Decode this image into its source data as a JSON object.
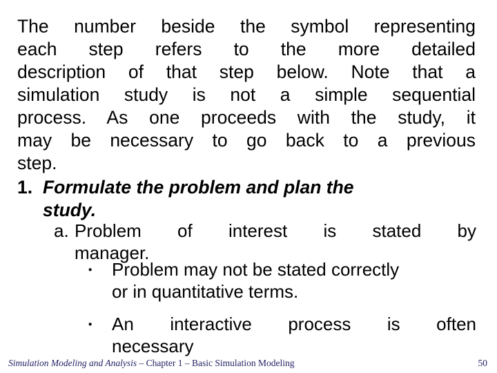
{
  "slide": {
    "background_color": "#ffffff",
    "text_color": "#000000",
    "footer_color": "#1f1f63",
    "paragraph": {
      "lines": [
        "The number beside the symbol representing",
        "each step refers to the more detailed",
        "description of that step below.  Note that a",
        "simulation study is not a simple sequential",
        "process.  As one proceeds with the study, it",
        "may be necessary to go back to a previous",
        "step."
      ]
    },
    "items": [
      {
        "marker": "1.",
        "lines": [
          "Formulate the problem and plan the",
          "study."
        ]
      },
      {
        "marker": "a.",
        "lines": [
          "Problem of interest is stated by",
          "manager."
        ]
      },
      {
        "marker": "§",
        "bullet_glyph": "▪",
        "lines": [
          "Problem may not be stated correctly",
          "or in quantitative terms."
        ]
      },
      {
        "marker": "§",
        "bullet_glyph": "▪",
        "lines": [
          "An interactive process is often",
          "necessary"
        ]
      }
    ],
    "footer": {
      "title_italic": "Simulation Modeling and Analysis",
      "rest": " – Chapter 1 –  Basic Simulation Modeling",
      "page_number": "50"
    }
  }
}
